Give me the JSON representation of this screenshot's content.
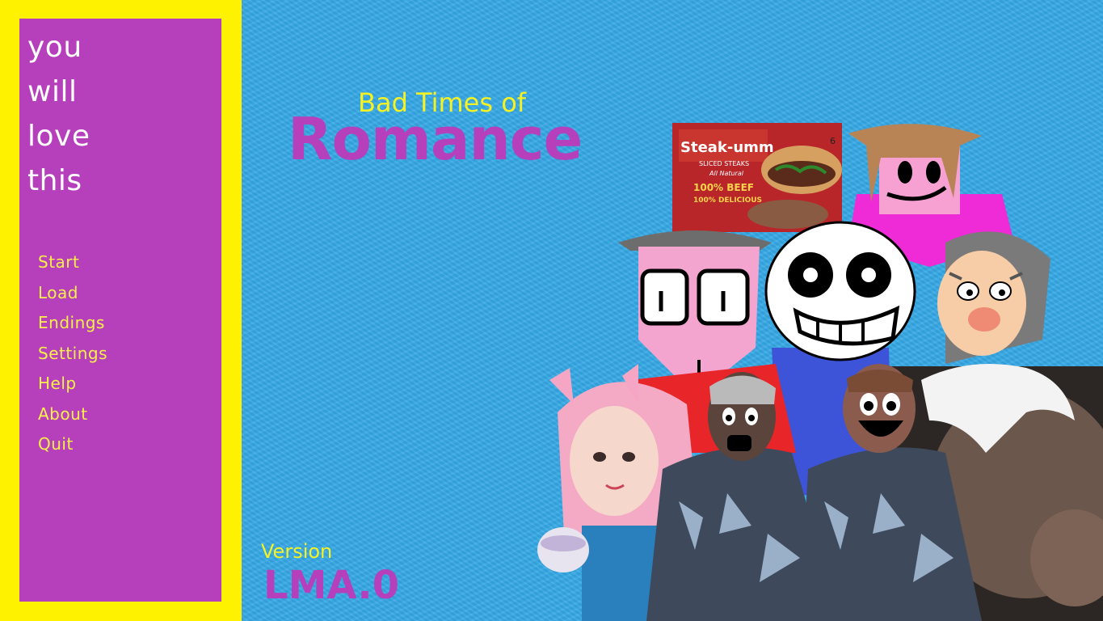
{
  "sidebar": {
    "tagline": [
      "you",
      "will",
      "love",
      "this"
    ],
    "menu": [
      "Start",
      "Load",
      "Endings",
      "Settings",
      "Help",
      "About",
      "Quit"
    ]
  },
  "title": {
    "subtitle": "Bad Times of",
    "main": "Romance"
  },
  "version": {
    "label": "Version",
    "value": "LMA.0"
  },
  "characters": {
    "product_box": {
      "brand": "Steak-umm",
      "line1": "SLICED STEAKS",
      "line2": "All Natural",
      "line3": "100% BEEF",
      "line4": "100% DELICIOUS",
      "count": "6"
    }
  },
  "colors": {
    "background": "#35a9e7",
    "frame": "#fff200",
    "panel": "#b63fbc",
    "menu_text": "#fff04a",
    "title_yellow": "#f4f224",
    "title_purple": "#b63fbc"
  }
}
